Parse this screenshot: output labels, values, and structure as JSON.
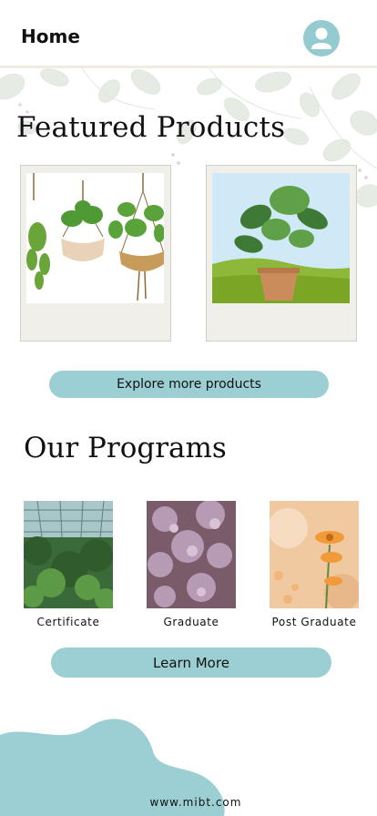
{
  "header": {
    "title": "Home",
    "avatar_icon": "user-avatar-icon"
  },
  "featured": {
    "title": "Featured Products",
    "products": [
      {
        "art": "hanging-plants-illustration"
      },
      {
        "art": "monstera-plant-illustration"
      }
    ],
    "explore_label": "Explore more products"
  },
  "programs": {
    "title": "Our Programs",
    "items": [
      {
        "label": "Certificate",
        "photo": "greenhouse-photo"
      },
      {
        "label": "Graduate",
        "photo": "lilac-flowers-photo"
      },
      {
        "label": "Post Graduate",
        "photo": "orange-flower-photo"
      }
    ],
    "learn_label": "Learn More"
  },
  "footer": {
    "url": "www.mibt.com"
  },
  "colors": {
    "accent": "#9ccfd3",
    "card_bg": "#f0efe9",
    "blob": "#9ccfd3"
  }
}
